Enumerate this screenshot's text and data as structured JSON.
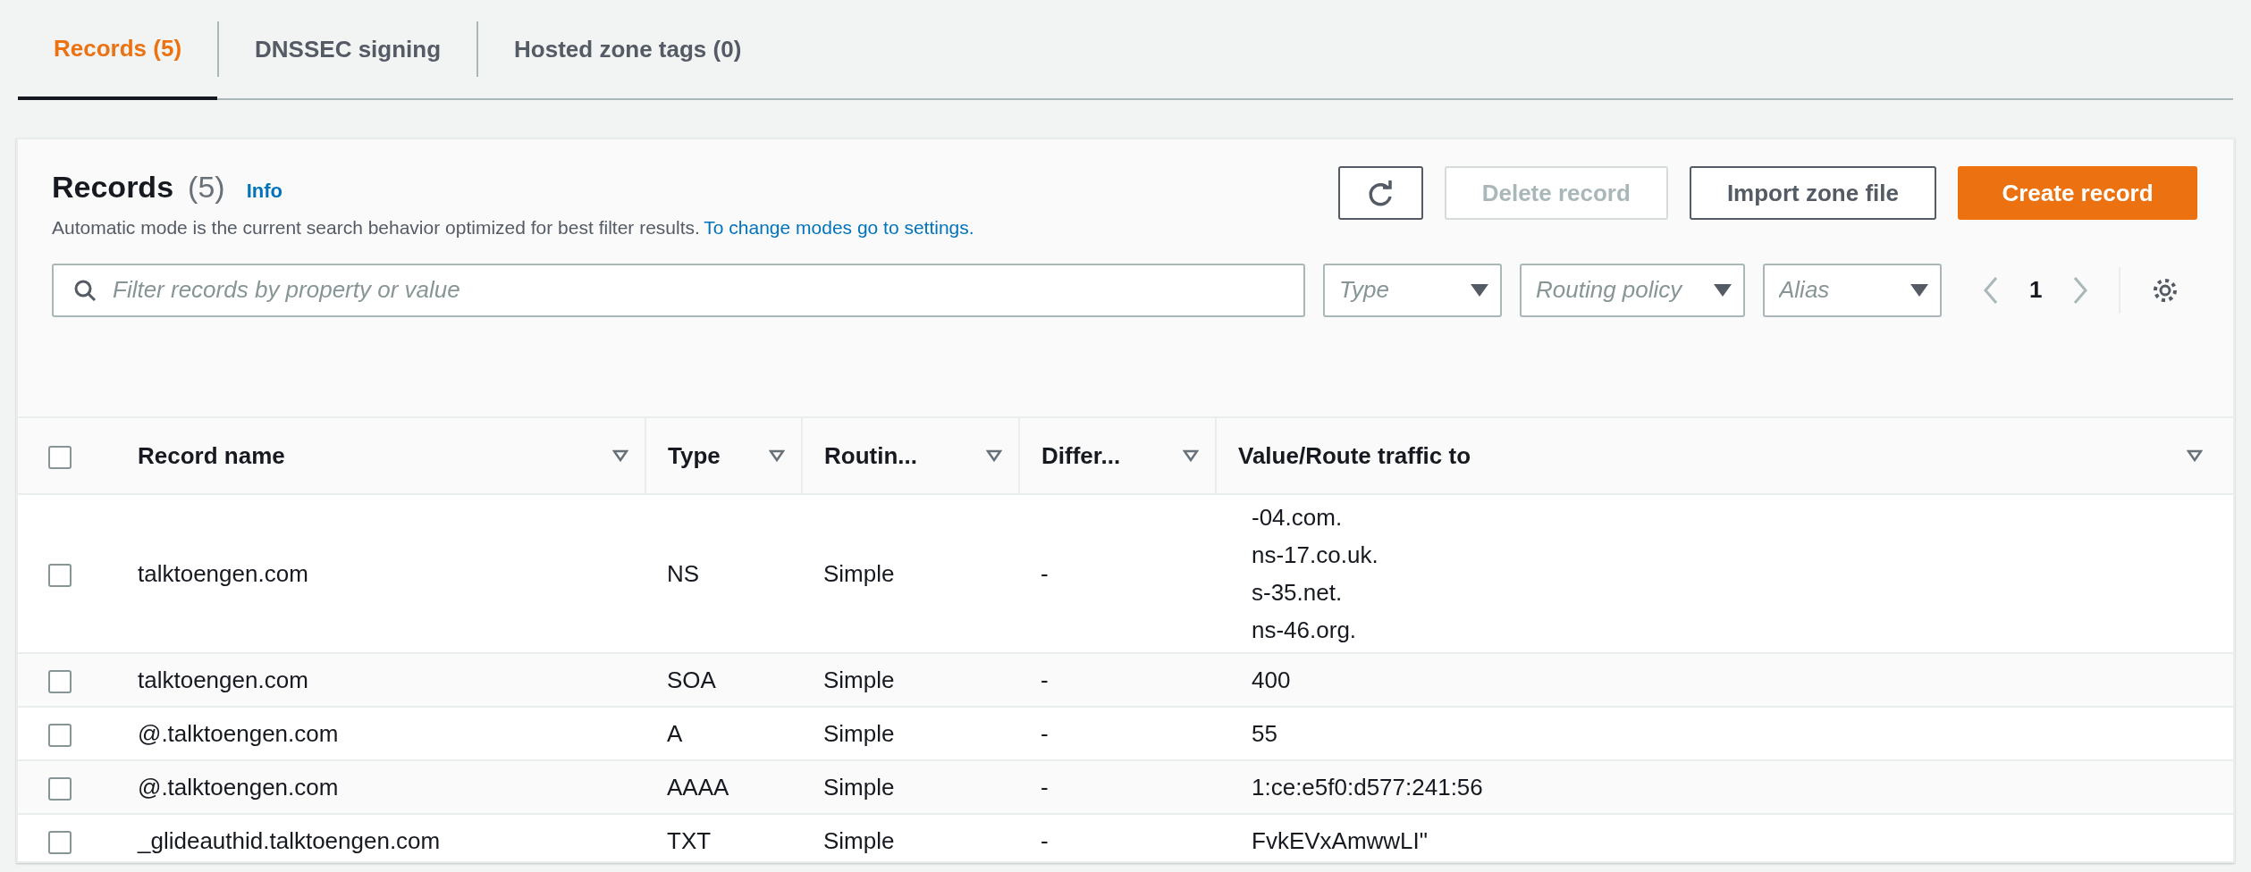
{
  "tabs": [
    {
      "label": "Records (5)",
      "selected": true
    },
    {
      "label": "DNSSEC signing",
      "selected": false
    },
    {
      "label": "Hosted zone tags (0)",
      "selected": false
    }
  ],
  "panel": {
    "title": "Records",
    "count": "(5)",
    "info": "Info",
    "description": "Automatic mode is the current search behavior optimized for best filter results.",
    "settings_link": "To change modes go to settings.",
    "buttons": [
      {
        "kind": "refresh",
        "disabled": false
      },
      {
        "kind": "normal",
        "label": "Delete record",
        "disabled": true
      },
      {
        "kind": "normal",
        "label": "Import zone file",
        "disabled": false
      },
      {
        "kind": "primary",
        "label": "Create record",
        "disabled": false
      }
    ],
    "search": {
      "placeholder": "Filter records by property or value"
    },
    "filters": [
      {
        "placeholder": "Type"
      },
      {
        "placeholder": "Routing policy"
      },
      {
        "placeholder": "Alias"
      }
    ],
    "page": "1"
  },
  "table": {
    "all_selected": false,
    "columns": [
      "Record name",
      "Type",
      "Routin...",
      "Differ...",
      "Value/Route traffic to"
    ],
    "rows": [
      {
        "selected": false,
        "name": "talktoengen.com",
        "type": "NS",
        "routing": "Simple",
        "differ": "-",
        "value": [
          "-04.com.",
          "ns-17.co.uk.",
          "s-35.net.",
          "ns-46.org."
        ]
      },
      {
        "selected": false,
        "name": "talktoengen.com",
        "type": "SOA",
        "routing": "Simple",
        "differ": "-",
        "value": [
          "400"
        ]
      },
      {
        "selected": false,
        "name": "@.talktoengen.com",
        "type": "A",
        "routing": "Simple",
        "differ": "-",
        "value": [
          "55"
        ]
      },
      {
        "selected": false,
        "name": "@.talktoengen.com",
        "type": "AAAA",
        "routing": "Simple",
        "differ": "-",
        "value": [
          "1:ce:e5f0:d577:241:56"
        ]
      },
      {
        "selected": false,
        "name": "_glideauthid.talktoengen.com",
        "type": "TXT",
        "routing": "Simple",
        "differ": "-",
        "value": [
          "FvkEVxAmwwLI\""
        ]
      }
    ]
  }
}
